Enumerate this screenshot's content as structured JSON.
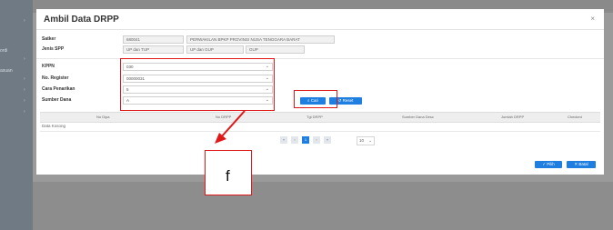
{
  "background": {
    "left_labels": [
      "ordi",
      "asuan"
    ]
  },
  "modal": {
    "title": "Ambil Data DRPP",
    "close_glyph": "×",
    "fields": {
      "satker_label": "Satker",
      "satker_code": "680041",
      "satker_name": "PERWAKILAN BPKP PROVINSI NUSA TENGGARA BARAT",
      "jenis_spp_label": "Jenis SPP",
      "jenis_spp_1": "UP dan TUP",
      "jenis_spp_2": "UP dan GUP",
      "jenis_spp_3": "GUP",
      "kppn_label": "KPPN",
      "kppn_value": "030",
      "register_label": "No. Register",
      "register_value": "00000031",
      "cara_label": "Cara Penarikan",
      "cara_value": "5",
      "sumber_label": "Sumber Dana",
      "sumber_value": "A"
    },
    "buttons": {
      "cari": "Cari",
      "reset": "Reset",
      "pilih": "Pilih",
      "batal": "Batal"
    },
    "table": {
      "columns": [
        "No Dipa",
        "No DRPP",
        "Tgl DRPP",
        "Sumber Dana Desc",
        "Jumlah DRPP",
        "Checked"
      ],
      "empty_text": "Data Kosong"
    },
    "pagination": {
      "first": "«",
      "prev": "‹",
      "current": "1",
      "next": "›",
      "last": "»",
      "page_size": "10"
    }
  },
  "annotation": {
    "callout_text": "f",
    "color": "#e01818"
  },
  "colors": {
    "primary": "#1f7fe0",
    "annotation_red": "#e01818"
  }
}
